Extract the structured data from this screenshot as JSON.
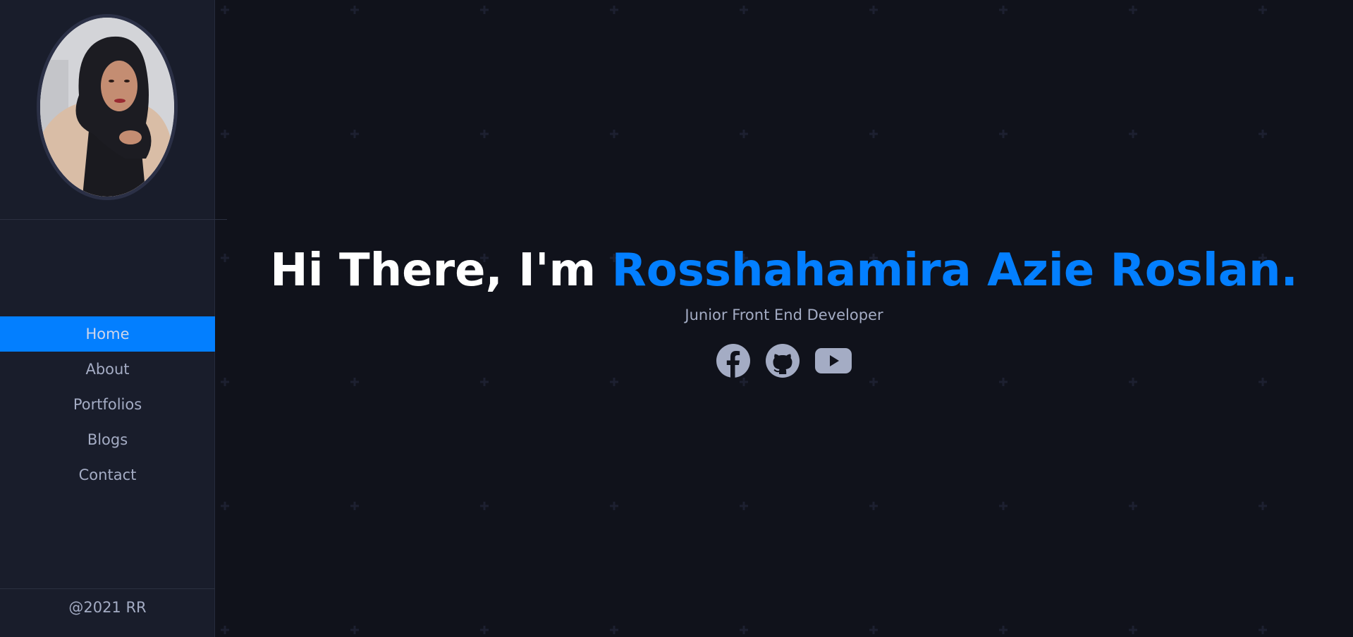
{
  "sidebar": {
    "profile_alt": "Profile photo",
    "nav": [
      {
        "label": "Home",
        "active": true
      },
      {
        "label": "About",
        "active": false
      },
      {
        "label": "Portfolios",
        "active": false
      },
      {
        "label": "Blogs",
        "active": false
      },
      {
        "label": "Contact",
        "active": false
      }
    ],
    "footer": "@2021 RR"
  },
  "hero": {
    "greeting": "Hi There, I'm ",
    "name": "Rosshahamira Azie Roslan.",
    "subtitle": "Junior Front End Developer"
  },
  "socials": [
    {
      "icon": "facebook-icon"
    },
    {
      "icon": "github-icon"
    },
    {
      "icon": "youtube-icon"
    }
  ],
  "colors": {
    "accent": "#037fff",
    "background": "#10121b",
    "sidebar": "#191d2b",
    "text": "#a4acc4"
  }
}
